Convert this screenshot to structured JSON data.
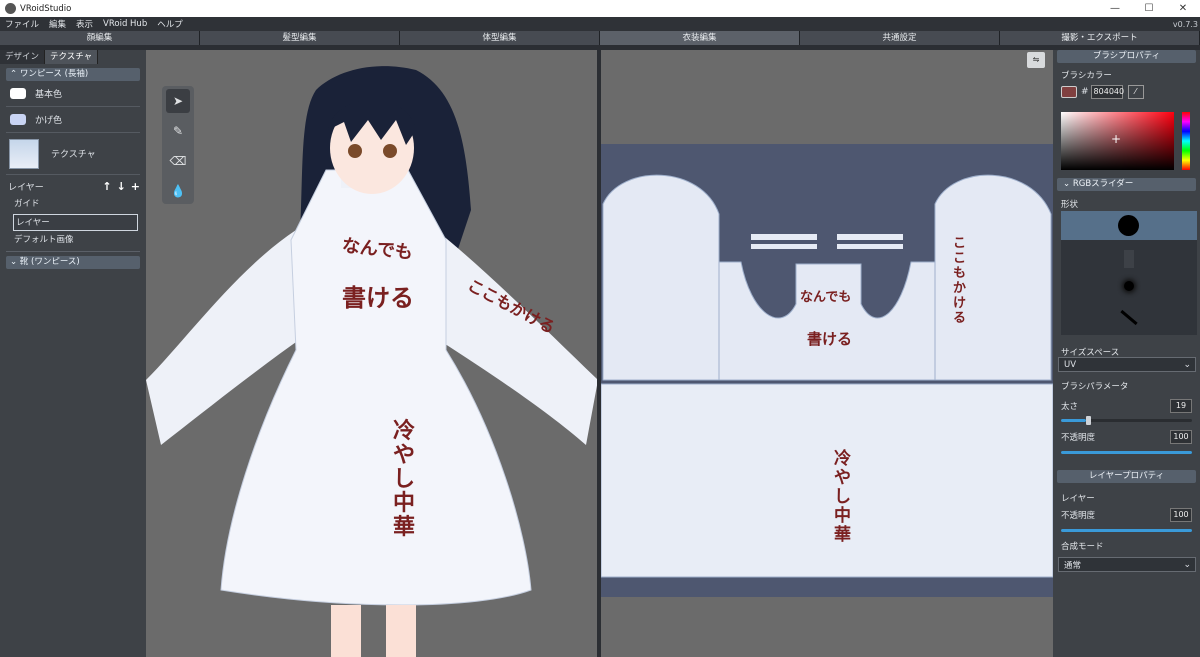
{
  "window": {
    "title": "VRoidStudio",
    "controls": [
      "—",
      "☐",
      "✕"
    ]
  },
  "menu": {
    "items": [
      "ファイル",
      "編集",
      "表示",
      "VRoid Hub",
      "ヘルプ"
    ],
    "version": "v0.7.3"
  },
  "main_tabs": [
    "顔編集",
    "髪型編集",
    "体型編集",
    "衣装編集",
    "共通設定",
    "撮影・エクスポート"
  ],
  "active_main_tab": 3,
  "left": {
    "subtabs": [
      "デザイン",
      "テクスチャ"
    ],
    "active_subtab": 1,
    "section_onepiece": "ワンピース (長袖)",
    "colors": [
      {
        "label": "基本色",
        "color": "#ffffff"
      },
      {
        "label": "かげ色",
        "color": "#c9d4f3"
      }
    ],
    "texture_label": "テクスチャ",
    "layer_label": "レイヤー",
    "layer_controls": [
      "↑",
      "↓",
      "+"
    ],
    "layers": [
      "ガイド",
      "レイヤー",
      "デフォルト画像"
    ],
    "selected_layer": 1,
    "section_shoes": "靴 (ワンピース)"
  },
  "canvas3d": {
    "tools": [
      "select-tool",
      "pen-tool",
      "eraser-tool",
      "fill-tool"
    ],
    "text_lines": [
      "なんでも",
      "書ける",
      "ここもかける",
      "冷やし中華"
    ]
  },
  "canvas2d": {
    "text_lines": [
      "なんでも",
      "書ける",
      "ここもかける",
      "冷やし中華"
    ],
    "corner_button": "⇋"
  },
  "right": {
    "brush_props_title": "ブラシプロパティ",
    "brush_color_label": "ブラシカラー",
    "hex_prefix": "#",
    "hex_value": "804040",
    "brush_color": "#804040",
    "rgb_slider_label": "RGBスライダー",
    "shape_label": "形状",
    "size_space_label": "サイズスペース",
    "size_space_value": "UV",
    "brush_params_label": "ブラシパラメータ",
    "thickness_label": "太さ",
    "thickness_value": "19",
    "thickness_fraction": 0.19,
    "opacity_label": "不透明度",
    "opacity_value": "100",
    "opacity_fraction": 1.0,
    "layer_props_title": "レイヤープロパティ",
    "layer_label": "レイヤー",
    "layer_opacity_label": "不透明度",
    "layer_opacity_value": "100",
    "layer_opacity_fraction": 1.0,
    "blend_mode_label": "合成モード",
    "blend_mode_value": "通常"
  }
}
